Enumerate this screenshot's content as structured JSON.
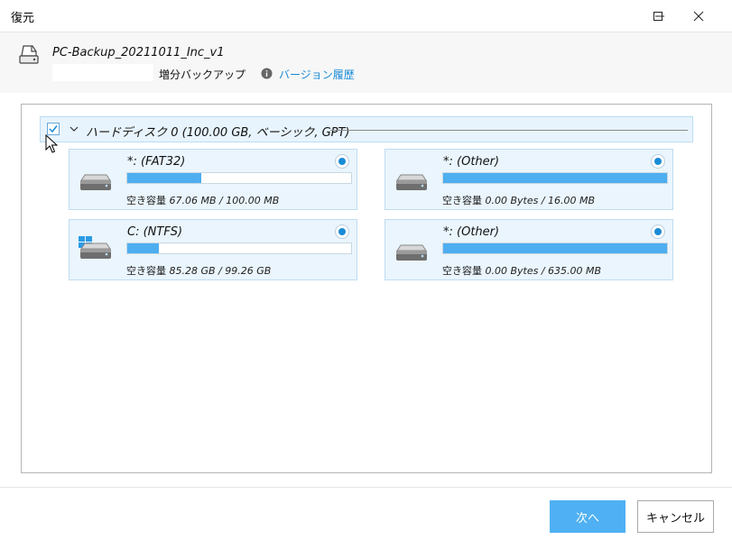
{
  "window": {
    "title": "復元",
    "minimize_icon": "minimize-icon",
    "maximize_icon": "maximize-icon",
    "close_icon": "close-icon"
  },
  "header": {
    "backup_name": "PC-Backup_20211011_Inc_v1",
    "backup_type": "増分バックアップ",
    "version_link": "バージョン履歴",
    "accent": "#1a8bd6"
  },
  "disk": {
    "checked": true,
    "label": "ハードディスク 0 (100.00 GB, ベーシック, GPT)"
  },
  "partitions": [
    {
      "name": "*: (FAT32)",
      "free_label": "空き容量",
      "free_value": "67.06 MB / 100.00 MB",
      "used_fraction": 0.33,
      "icon": "drive-icon",
      "selected": true
    },
    {
      "name": "*: (Other)",
      "free_label": "空き容量",
      "free_value": "0.00 Bytes / 16.00 MB",
      "used_fraction": 1.0,
      "icon": "drive-icon",
      "selected": true
    },
    {
      "name": "C: (NTFS)",
      "free_label": "空き容量",
      "free_value": "85.28 GB / 99.26 GB",
      "used_fraction": 0.14,
      "icon": "windows-drive-icon",
      "selected": true
    },
    {
      "name": "*: (Other)",
      "free_label": "空き容量",
      "free_value": "0.00 Bytes / 635.00 MB",
      "used_fraction": 1.0,
      "icon": "drive-icon",
      "selected": true
    }
  ],
  "footer": {
    "next_label": "次へ",
    "cancel_label": "キャンセル"
  }
}
